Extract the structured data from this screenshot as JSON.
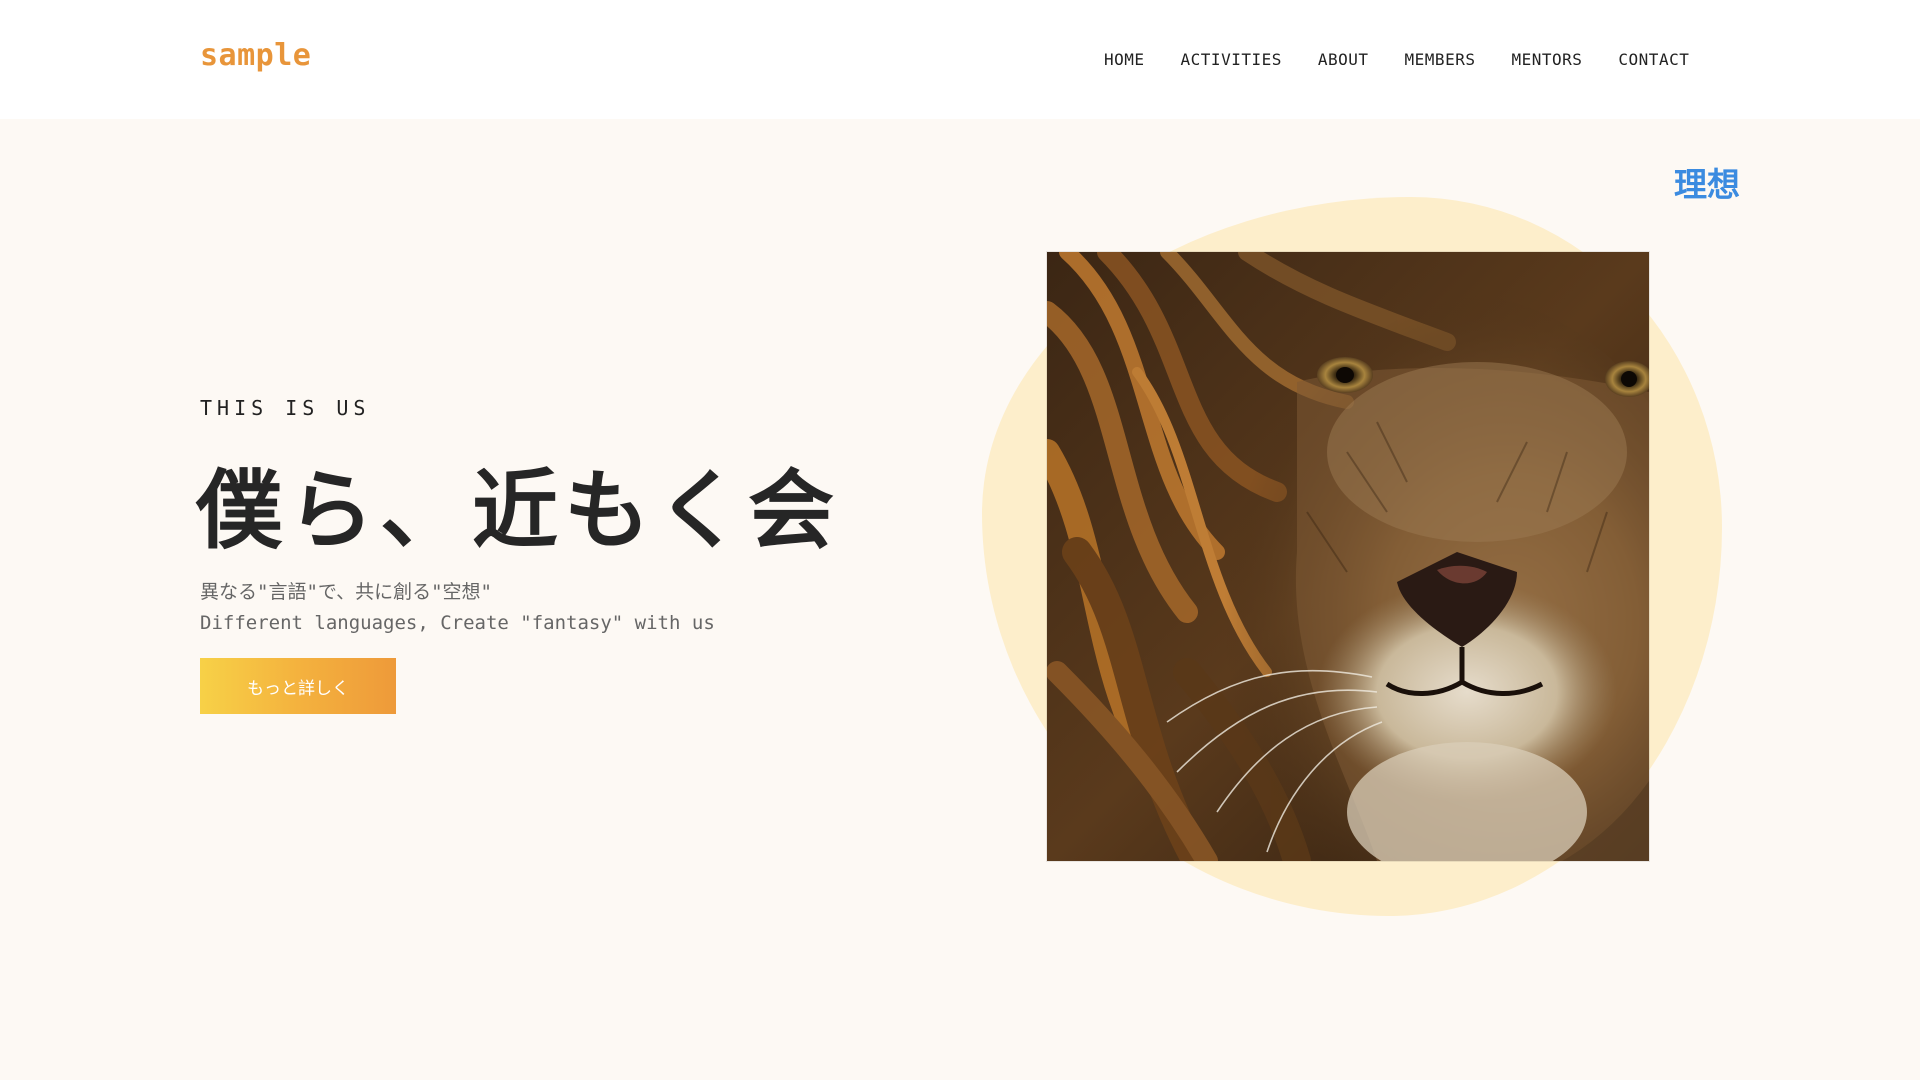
{
  "header": {
    "logo": "sample",
    "nav": [
      {
        "label": "HOME"
      },
      {
        "label": "ACTIVITIES"
      },
      {
        "label": "ABOUT"
      },
      {
        "label": "MEMBERS"
      },
      {
        "label": "MENTORS"
      },
      {
        "label": "CONTACT"
      }
    ]
  },
  "hero": {
    "eyebrow": "THIS IS US",
    "title": "僕ら、近もく会",
    "subtitle_jp": "異なる\"言語\"で、共に創る\"空想\"",
    "subtitle_en": "Different languages, Create \"fantasy\" with us",
    "button_label": "もっと詳しく",
    "side_label": "理想"
  },
  "colors": {
    "accent": "#e8953a",
    "button_start": "#f7d147",
    "button_end": "#ee9a3a",
    "blob": "#fdeecb",
    "side_label": "#3b8be0",
    "background": "#fdf9f4"
  }
}
